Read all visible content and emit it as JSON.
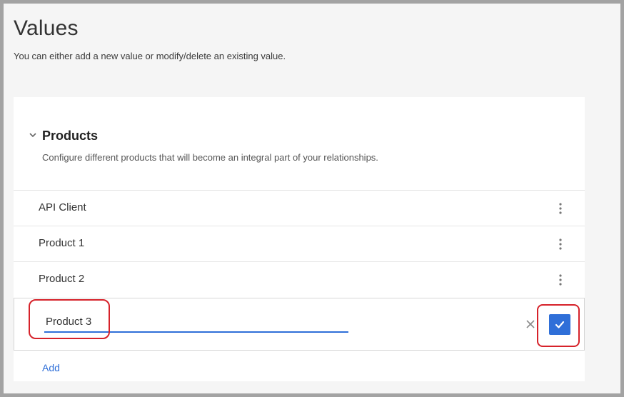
{
  "page": {
    "title": "Values",
    "subtitle": "You can either add a new value or modify/delete an existing value."
  },
  "section": {
    "title": "Products",
    "description": "Configure different products that will become an integral part of your relationships.",
    "expanded_icon": "chevron-down-icon"
  },
  "items": [
    {
      "label": "API Client",
      "menu_icon": "kebab-menu-icon"
    },
    {
      "label": "Product 1",
      "menu_icon": "kebab-menu-icon"
    },
    {
      "label": "Product 2",
      "menu_icon": "kebab-menu-icon"
    }
  ],
  "edit": {
    "value": "Product 3",
    "cancel_icon": "close-icon",
    "confirm_icon": "checkmark-icon"
  },
  "add_label": "Add",
  "colors": {
    "accent": "#2f6fd8",
    "annotation": "#d6222a",
    "background": "#f5f5f5"
  }
}
